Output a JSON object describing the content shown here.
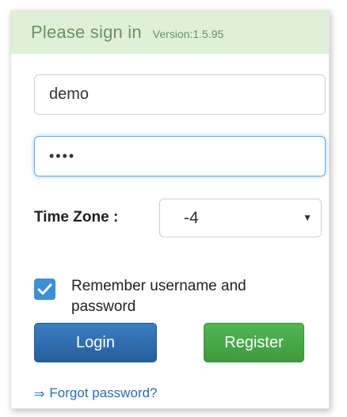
{
  "header": {
    "title": "Please sign in",
    "version": "Version:1.5.95"
  },
  "username": {
    "value": "demo"
  },
  "password": {
    "value": "••••"
  },
  "timezone": {
    "label": "Time Zone :",
    "selected": "-4",
    "caret": "▼"
  },
  "remember": {
    "checked": true,
    "label": "Remember username and password"
  },
  "buttons": {
    "login": "Login",
    "register": "Register"
  },
  "forgot": {
    "arrow": "⇒",
    "label": "Forgot password?"
  },
  "colors": {
    "header_bg": "#dff0d8",
    "login": "#2f6eaf",
    "register": "#46a846",
    "checkbox": "#3d8fd6",
    "link": "#2a6db3"
  }
}
